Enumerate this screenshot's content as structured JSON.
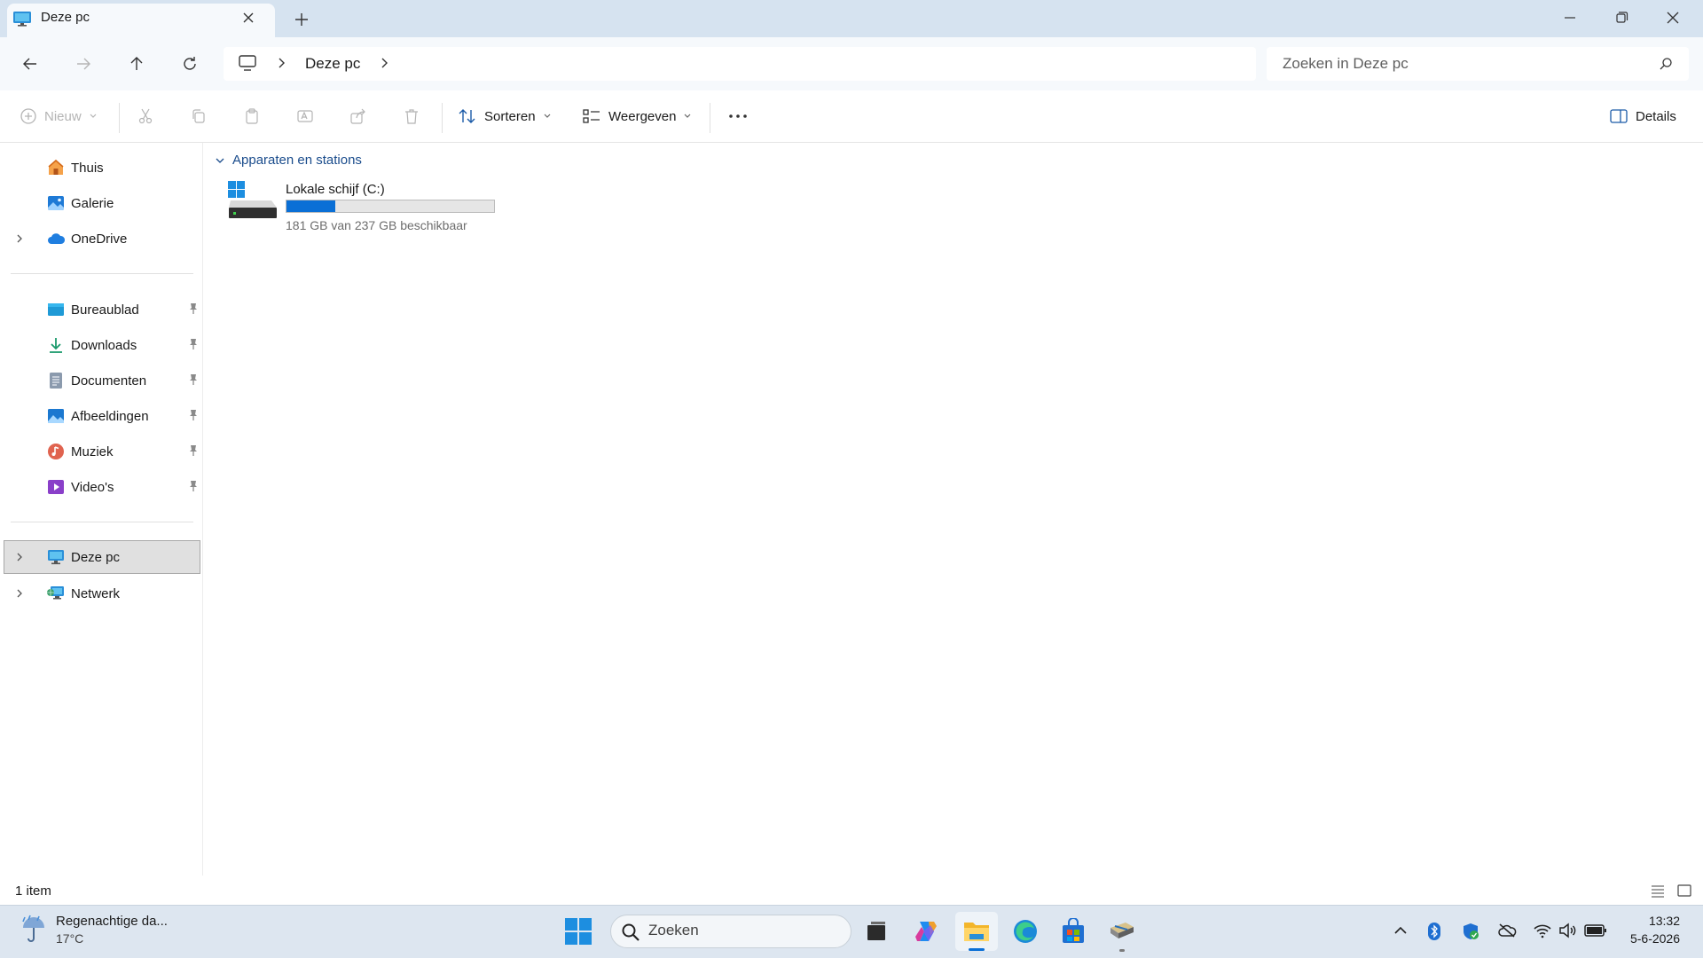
{
  "window": {
    "tab_title": "Deze pc",
    "tab_icon": "monitor-icon"
  },
  "address": {
    "path": "Deze pc",
    "search_placeholder": "Zoeken in Deze pc"
  },
  "toolbar": {
    "new_label": "Nieuw",
    "sort_label": "Sorteren",
    "view_label": "Weergeven",
    "details_label": "Details"
  },
  "sidebar": {
    "top_items": [
      {
        "label": "Thuis",
        "icon": "home-icon"
      },
      {
        "label": "Galerie",
        "icon": "gallery-icon"
      },
      {
        "label": "OneDrive",
        "icon": "cloud-icon"
      }
    ],
    "pinned_items": [
      {
        "label": "Bureaublad",
        "icon": "desktop-icon"
      },
      {
        "label": "Downloads",
        "icon": "download-icon"
      },
      {
        "label": "Documenten",
        "icon": "document-icon"
      },
      {
        "label": "Afbeeldingen",
        "icon": "image-icon"
      },
      {
        "label": "Muziek",
        "icon": "music-icon"
      },
      {
        "label": "Video's",
        "icon": "video-icon"
      }
    ],
    "bottom_items": [
      {
        "label": "Deze pc",
        "icon": "monitor-icon",
        "selected": true
      },
      {
        "label": "Netwerk",
        "icon": "network-icon"
      }
    ]
  },
  "content": {
    "group_header": "Apparaten en stations",
    "drives": [
      {
        "name": "Lokale schijf (C:)",
        "free_text": "181 GB van 237 GB beschikbaar",
        "used_fraction": 0.236
      }
    ]
  },
  "status": {
    "item_count": "1 item"
  },
  "taskbar": {
    "weather_desc": "Regenachtige da...",
    "weather_temp": "17°C",
    "search_placeholder": "Zoeken",
    "apps": [
      "task-view-icon",
      "copilot-icon",
      "file-explorer-icon",
      "edge-icon",
      "store-icon",
      "app-icon"
    ],
    "time": "13:32",
    "date": "5-6-2026"
  },
  "colors": {
    "accent": "#0a6fd6",
    "titlebar": "#d6e3f0",
    "selected": "#e0e0e0"
  }
}
